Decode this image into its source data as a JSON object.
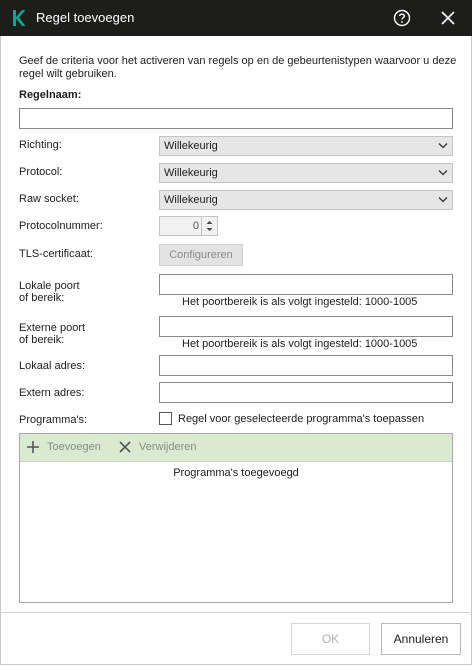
{
  "window": {
    "title": "Regel toevoegen",
    "brand_color": "#00a88e",
    "titlebar_color": "#1d1d1b"
  },
  "description": "Geef de criteria voor het activeren van regels op en de gebeurtenistypen waarvoor u deze regel wilt gebruiken.",
  "fields": {
    "rule_name": {
      "label": "Regelnaam:",
      "value": ""
    },
    "direction": {
      "label": "Richting:",
      "value": "Willekeurig"
    },
    "protocol": {
      "label": "Protocol:",
      "value": "Willekeurig"
    },
    "raw_socket": {
      "label": "Raw socket:",
      "value": "Willekeurig"
    },
    "protocol_number": {
      "label": "Protocolnummer:",
      "value": "0"
    },
    "tls_certificate": {
      "label": "TLS-certificaat:",
      "button": "Configureren"
    },
    "local_port": {
      "label_line1": "Lokale poort",
      "label_line2": "of bereik:",
      "value": "",
      "hint": "Het poortbereik is als volgt ingesteld: 1000-1005"
    },
    "remote_port": {
      "label_line1": "Externe poort",
      "label_line2": "of bereik:",
      "value": "",
      "hint": "Het poortbereik is als volgt ingesteld: 1000-1005"
    },
    "local_address": {
      "label": "Lokaal adres:",
      "value": ""
    },
    "remote_address": {
      "label": "Extern adres:",
      "value": ""
    },
    "programs": {
      "label": "Programma's:",
      "checkbox_label": "Regel voor geselecteerde programma's toepassen",
      "checked": false
    }
  },
  "programs_panel": {
    "add_label": "Toevoegen",
    "remove_label": "Verwijderen",
    "empty_text": "Programma's toegevoegd",
    "toolbar_color": "#d8ebd0"
  },
  "buttons": {
    "ok": "OK",
    "cancel": "Annuleren"
  },
  "icons": [
    "kaspersky-logo-icon",
    "help-icon",
    "close-icon",
    "chevron-down-icon",
    "spin-arrows-icon",
    "plus-icon",
    "x-icon"
  ]
}
